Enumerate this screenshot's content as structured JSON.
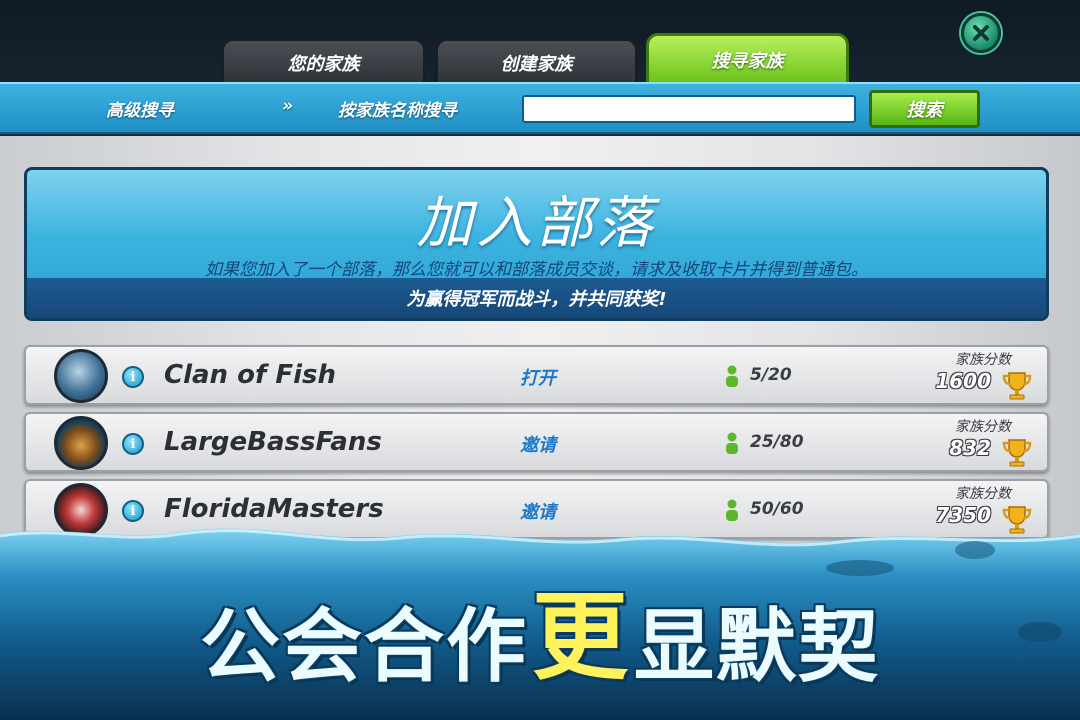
{
  "tabs": [
    {
      "label": "您的家族",
      "active": false
    },
    {
      "label": "创建家族",
      "active": false
    },
    {
      "label": "搜寻家族",
      "active": true
    }
  ],
  "search": {
    "advanced_label": "高级搜寻",
    "arrow": "»",
    "by_name_label": "按家族名称搜寻",
    "input_value": "",
    "button_label": "搜索"
  },
  "banner": {
    "title": "加入部落",
    "description": "如果您加入了一个部落，那么您就可以和部落成员交谈，请求及收取卡片并得到普通包。",
    "subtitle": "为赢得冠军而战斗，并共同获奖!"
  },
  "clans": [
    {
      "name": "Clan of Fish",
      "status": "打开",
      "members": "5/20",
      "score_label": "家族分数",
      "score": "1600"
    },
    {
      "name": "LargeBassFans",
      "status": "邀请",
      "members": "25/80",
      "score_label": "家族分数",
      "score": "832"
    },
    {
      "name": "FloridaMasters",
      "status": "邀请",
      "members": "50/60",
      "score_label": "家族分数",
      "score": "7350"
    }
  ],
  "slogan": {
    "part1": "公会合作",
    "part2": "更",
    "part3": "显默契"
  },
  "colors": {
    "accent_green": "#6cc21c",
    "accent_blue": "#1f8fc4",
    "status_blue": "#1d79c9"
  },
  "icons": {
    "close": "close-icon",
    "info": "info-icon",
    "member": "member-icon",
    "trophy": "trophy-icon"
  }
}
